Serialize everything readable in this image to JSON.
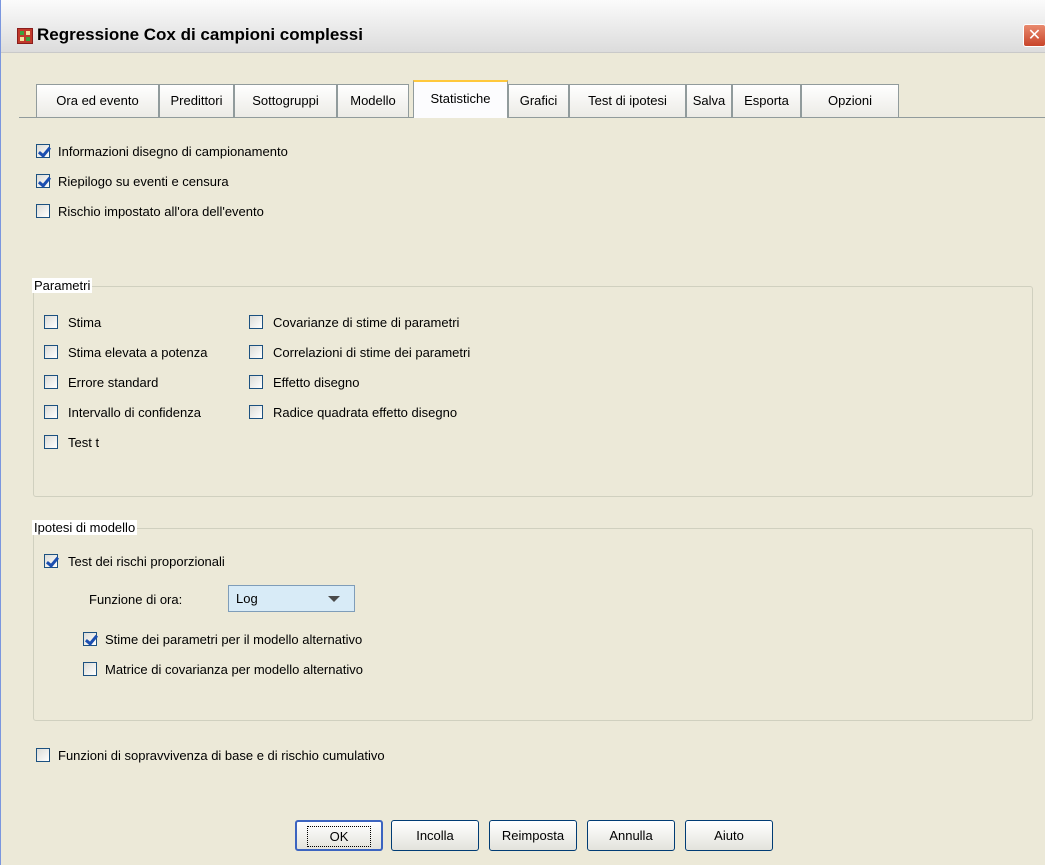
{
  "window": {
    "title": "Regressione Cox di campioni complessi",
    "close_glyph": "✕"
  },
  "tabs": [
    {
      "label": "Ora ed evento"
    },
    {
      "label": "Predittori"
    },
    {
      "label": "Sottogruppi"
    },
    {
      "label": "Modello"
    },
    {
      "label": "Statistiche",
      "active": true
    },
    {
      "label": "Grafici"
    },
    {
      "label": "Test di ipotesi"
    },
    {
      "label": "Salva"
    },
    {
      "label": "Esporta"
    },
    {
      "label": "Opzioni"
    }
  ],
  "top_options": [
    {
      "label": "Informazioni disegno di campionamento",
      "checked": true
    },
    {
      "label": "Riepilogo su eventi e censura",
      "checked": true
    },
    {
      "label": "Rischio impostato all'ora dell'evento",
      "checked": false
    }
  ],
  "parametri": {
    "title": "Parametri",
    "col1": [
      {
        "label": "Stima",
        "checked": false
      },
      {
        "label": "Stima elevata a potenza",
        "checked": false
      },
      {
        "label": "Errore standard",
        "checked": false
      },
      {
        "label": "Intervallo di confidenza",
        "checked": false
      },
      {
        "label": "Test t",
        "checked": false
      }
    ],
    "col2": [
      {
        "label": "Covarianze di stime di parametri",
        "checked": false
      },
      {
        "label": "Correlazioni di stime dei parametri",
        "checked": false
      },
      {
        "label": "Effetto disegno",
        "checked": false
      },
      {
        "label": "Radice quadrata effetto disegno",
        "checked": false
      }
    ]
  },
  "ipotesi": {
    "title": "Ipotesi di modello",
    "test_rischi": {
      "label": "Test dei rischi proporzionali",
      "checked": true
    },
    "funzione_label": "Funzione di ora:",
    "funzione_value": "Log",
    "stime_alt": {
      "label": "Stime dei parametri per il modello alternativo",
      "checked": true
    },
    "matrice_alt": {
      "label": "Matrice di covarianza per modello alternativo",
      "checked": false
    }
  },
  "bottom_option": {
    "label": "Funzioni di sopravvivenza di base e di rischio cumulativo",
    "checked": false
  },
  "buttons": {
    "ok": "OK",
    "incolla": "Incolla",
    "reimposta": "Reimposta",
    "annulla": "Annulla",
    "aiuto": "Aiuto"
  }
}
